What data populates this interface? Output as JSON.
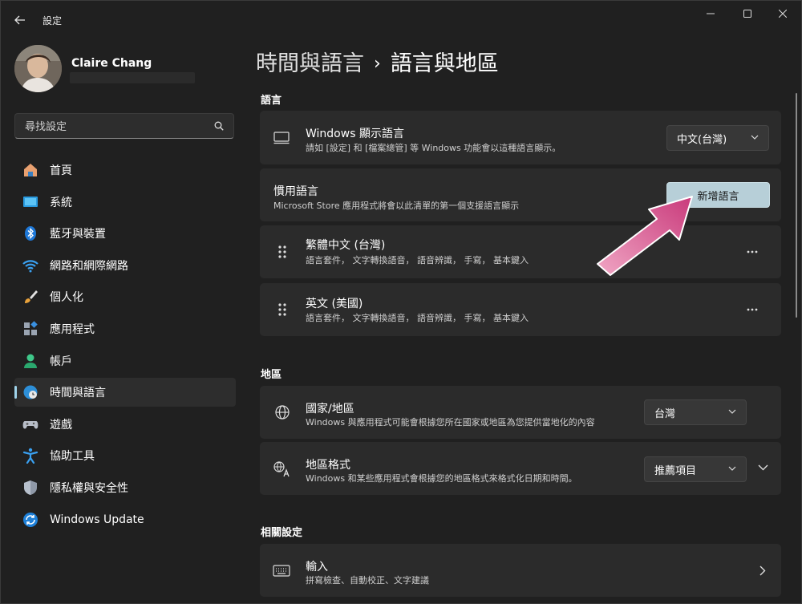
{
  "app": {
    "title": "設定"
  },
  "window": {
    "controls": [
      "minimize",
      "maximize",
      "close"
    ]
  },
  "profile": {
    "name": "Claire Chang"
  },
  "search": {
    "placeholder": "尋找設定"
  },
  "sidebar": {
    "items": [
      {
        "label": "首頁",
        "icon": "home-icon",
        "active": false
      },
      {
        "label": "系統",
        "icon": "system-icon",
        "active": false
      },
      {
        "label": "藍牙與裝置",
        "icon": "bluetooth-icon",
        "active": false
      },
      {
        "label": "網路和網際網路",
        "icon": "wifi-icon",
        "active": false
      },
      {
        "label": "個人化",
        "icon": "brush-icon",
        "active": false
      },
      {
        "label": "應用程式",
        "icon": "apps-icon",
        "active": false
      },
      {
        "label": "帳戶",
        "icon": "account-icon",
        "active": false
      },
      {
        "label": "時間與語言",
        "icon": "globe-clock-icon",
        "active": true
      },
      {
        "label": "遊戲",
        "icon": "gamepad-icon",
        "active": false
      },
      {
        "label": "協助工具",
        "icon": "accessibility-icon",
        "active": false
      },
      {
        "label": "隱私權與安全性",
        "icon": "shield-icon",
        "active": false
      },
      {
        "label": "Windows Update",
        "icon": "update-icon",
        "active": false
      }
    ]
  },
  "breadcrumb": {
    "parent": "時間與語言",
    "separator": "›",
    "current": "語言與地區"
  },
  "language": {
    "header": "語言",
    "display": {
      "title": "Windows 顯示語言",
      "subtitle": "請如 [設定] 和 [檔案總管] 等 Windows 功能會以這種語言顯示。",
      "value": "中文(台灣)"
    },
    "preferred": {
      "title": "慣用語言",
      "subtitle": "Microsoft Store 應用程式將會以此清單的第一個支援語言顯示",
      "add_button": "新增語言"
    },
    "list": [
      {
        "name": "繁體中文 (台灣)",
        "features": "語言套件， 文字轉換語音， 語音辨識， 手寫， 基本鍵入"
      },
      {
        "name": "英文 (美國)",
        "features": "語言套件， 文字轉換語音， 語音辨識， 手寫， 基本鍵入"
      }
    ]
  },
  "region": {
    "header": "地區",
    "country": {
      "title": "國家/地區",
      "subtitle": "Windows 與應用程式可能會根據您所在國家或地區為您提供當地化的內容",
      "value": "台灣"
    },
    "format": {
      "title": "地區格式",
      "subtitle": "Windows 和某些應用程式會根據您的地區格式來格式化日期和時間。",
      "value": "推薦項目"
    }
  },
  "related": {
    "header": "相關設定",
    "input": {
      "title": "輸入",
      "subtitle": "拼寫檢查、自動校正、文字建議"
    }
  },
  "colors": {
    "accent": "#9fd3ea",
    "primary_button": "#b7cfd8",
    "arrow": "#d4508a"
  }
}
